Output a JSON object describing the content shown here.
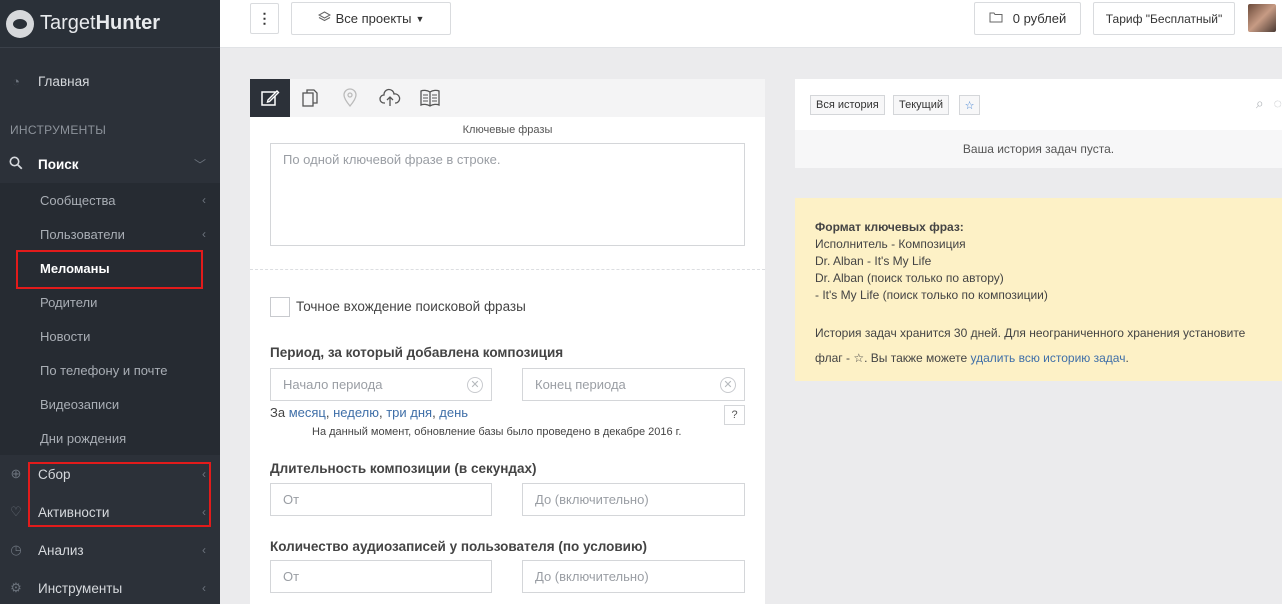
{
  "app": {
    "logo_text_light": "Target",
    "logo_text_bold": "Hunter"
  },
  "header": {
    "menu_label": "⋮",
    "projects_label": "Все проекты",
    "balance_label": "0 рублей",
    "tariff_label": "Тариф \"Бесплатный\""
  },
  "sidebar": {
    "home": "Главная",
    "tools_header": "ИНСТРУМЕНТЫ",
    "search": "Поиск",
    "search_items": [
      "Сообщества",
      "Пользователи",
      "Меломаны",
      "Родители",
      "Новости",
      "По телефону и почте",
      "Видеозаписи",
      "Дни рождения"
    ],
    "collect": "Сбор",
    "activity": "Активности",
    "analysis": "Анализ",
    "tools": "Инструменты"
  },
  "form": {
    "keywords_caption": "Ключевые фразы",
    "keywords_placeholder": "По одной ключевой фразе в строке.",
    "exact_match_label": "Точное вхождение поисковой фразы",
    "period_title": "Период, за который добавлена композиция",
    "period_start_placeholder": "Начало периода",
    "period_end_placeholder": "Конец периода",
    "period_prefix": "За",
    "period_links": [
      "месяц",
      "неделю",
      "три дня",
      "день"
    ],
    "help_label": "?",
    "db_note": "На данный момент, обновление базы было проведено в декабре 2016 г.",
    "duration_title": "Длительность композиции (в секундах)",
    "duration_from": "От",
    "duration_to": "До (включительно)",
    "audio_count_title": "Количество аудиозаписей у пользователя (по условию)",
    "audio_from": "От",
    "audio_to": "До (включительно)"
  },
  "history": {
    "chip_all": "Вся история",
    "chip_current": "Текущий",
    "empty_text": "Ваша история задач пуста."
  },
  "info": {
    "title": "Формат ключевых фраз:",
    "lines": [
      "Исполнитель - Композиция",
      "Dr. Alban - It's My Life",
      "Dr. Alban (поиск только по автору)",
      "- It's My Life (поиск только по композиции)"
    ],
    "storage_text_1": "История задач хранится 30 дней. Для неограниченного хранения установите",
    "storage_text_2": "флаг -",
    "storage_text_3": ". Вы также можете",
    "delete_link": "удалить всю историю задач",
    "storage_text_4": "."
  },
  "colors": {
    "sidebar_bg": "#2c3139",
    "highlight_red": "#e21b1b",
    "link": "#3f6fa8",
    "info_bg": "#fdf1c6"
  }
}
